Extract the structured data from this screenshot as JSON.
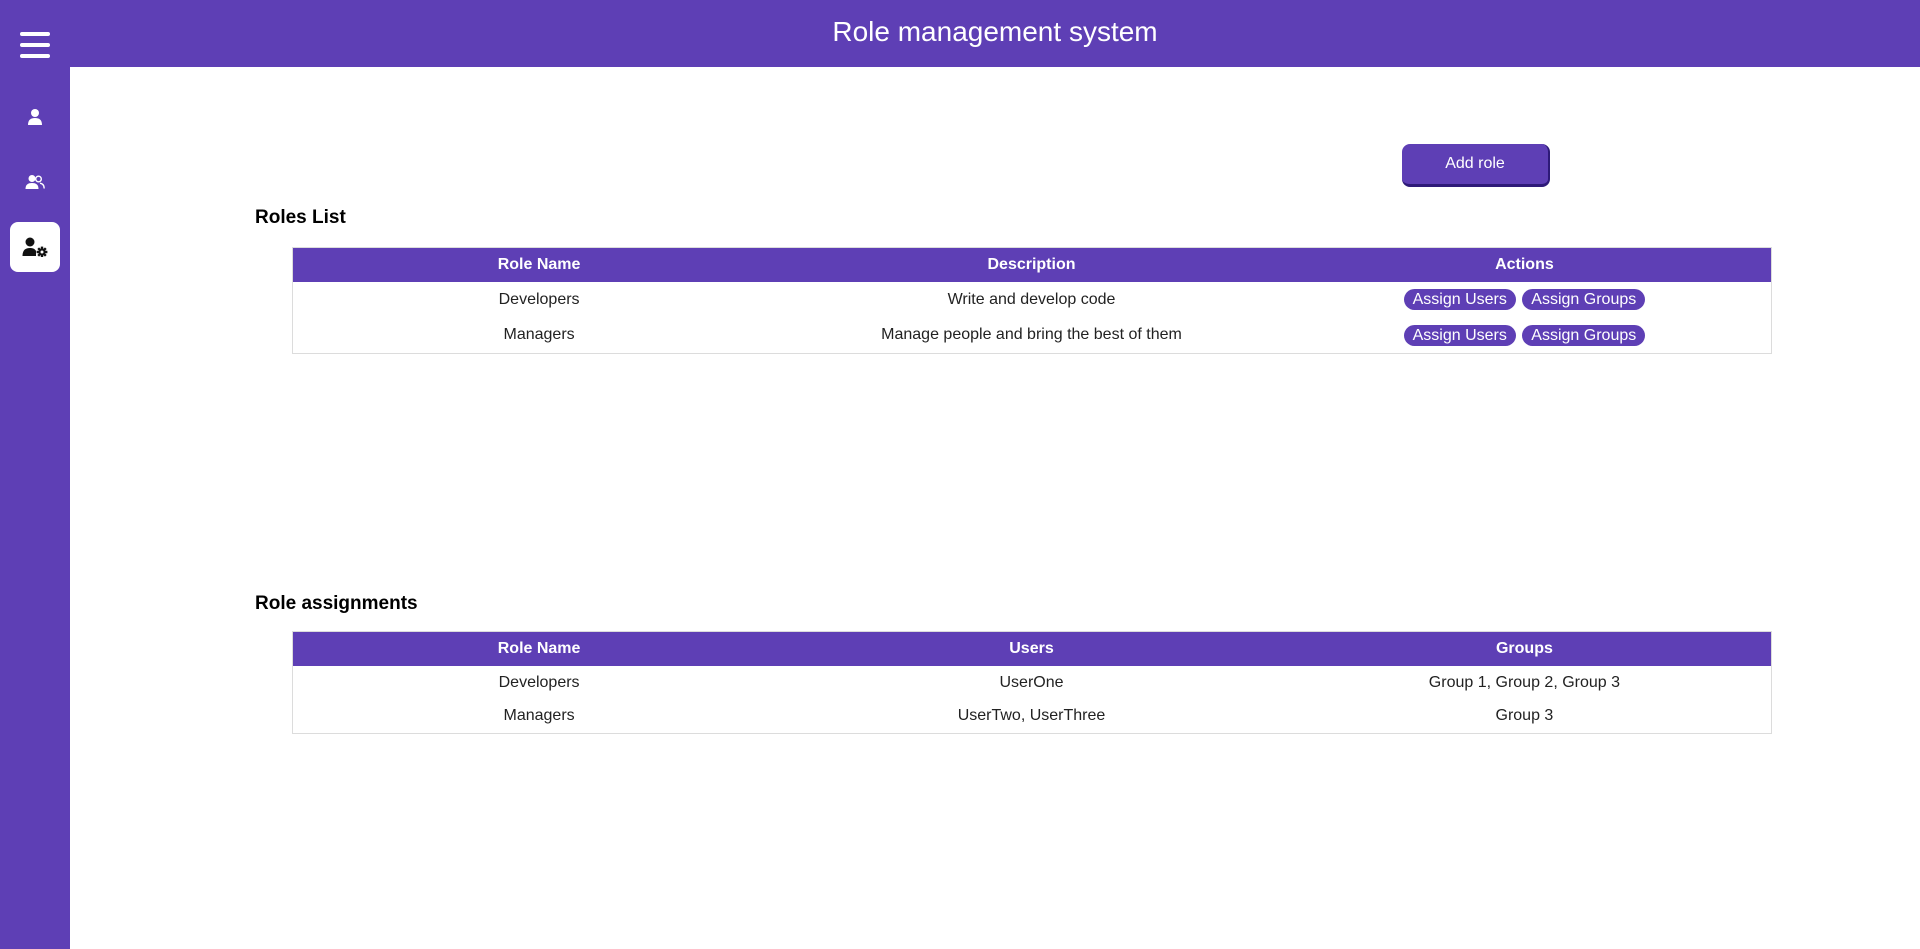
{
  "header": {
    "title": "Role management system"
  },
  "sidebar": {
    "items": [
      {
        "icon": "menu-icon"
      },
      {
        "icon": "user-icon"
      },
      {
        "icon": "users-icon"
      },
      {
        "icon": "user-gear-icon",
        "active": true
      }
    ]
  },
  "toolbar": {
    "add_role_label": "Add role"
  },
  "roles_list": {
    "title": "Roles List",
    "columns": [
      "Role Name",
      "Description",
      "Actions"
    ],
    "rows": [
      {
        "name": "Developers",
        "description": "Write and develop code",
        "assign_users": "Assign Users",
        "assign_groups": "Assign Groups"
      },
      {
        "name": "Managers",
        "description": "Manage people and bring the best of them",
        "assign_users": "Assign Users",
        "assign_groups": "Assign Groups"
      }
    ]
  },
  "role_assignments": {
    "title": "Role assignments",
    "columns": [
      "Role Name",
      "Users",
      "Groups"
    ],
    "rows": [
      {
        "name": "Developers",
        "users": "UserOne",
        "groups": "Group 1, Group 2, Group 3"
      },
      {
        "name": "Managers",
        "users": "UserTwo, UserThree",
        "groups": "Group 3"
      }
    ]
  },
  "colors": {
    "accent": "#5e3fb5",
    "accent_dark": "#2e1a78",
    "background": "#ffffff"
  }
}
